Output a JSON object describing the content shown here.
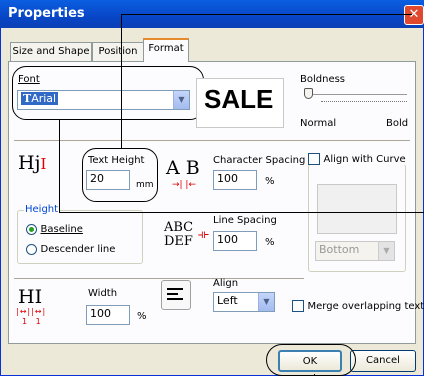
{
  "window": {
    "title": "Properties"
  },
  "tabs": [
    "Size and Shape",
    "Position",
    "Format"
  ],
  "font": {
    "label": "Font",
    "value": "Arial"
  },
  "sample": "SALE",
  "boldness": {
    "label": "Boldness",
    "min_label": "Normal",
    "max_label": "Bold",
    "level": 0
  },
  "text_height": {
    "label": "Text Height",
    "value": "20",
    "unit": "mm",
    "glyph": "Hj"
  },
  "char_spacing": {
    "label": "Character Spacing",
    "value": "100",
    "unit": "%",
    "glyph": "A B"
  },
  "align_curve": {
    "label": "Align with Curve",
    "select": "Bottom",
    "checked": false
  },
  "height_group": {
    "label": "Height",
    "options": [
      "Baseline",
      "Descender line"
    ],
    "selected": "Baseline"
  },
  "line_spacing": {
    "label": "Line Spacing",
    "value": "100",
    "unit": "%",
    "glyph1": "ABC",
    "glyph2": "DEF"
  },
  "width": {
    "label": "Width",
    "value": "100",
    "unit": "%",
    "glyph": "HI",
    "ticks": "1 1"
  },
  "align": {
    "label": "Align",
    "value": "Left"
  },
  "merge": {
    "label": "Merge overlapping text",
    "checked": false
  },
  "buttons": {
    "ok": "OK",
    "cancel": "Cancel"
  }
}
